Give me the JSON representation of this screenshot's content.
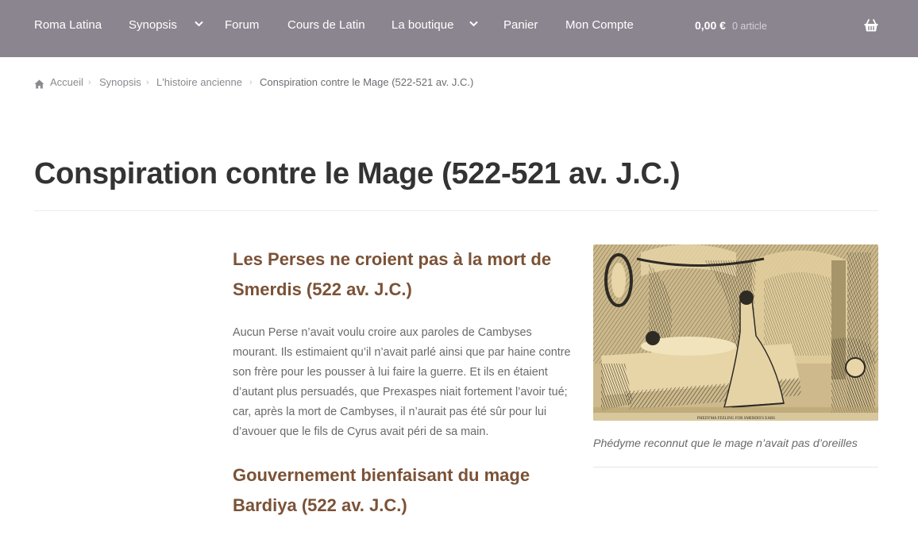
{
  "header": {
    "nav": [
      {
        "label": "Roma Latina"
      },
      {
        "label": "Synopsis",
        "has_dropdown": true
      },
      {
        "label": "Forum"
      },
      {
        "label": "Cours de Latin"
      },
      {
        "label": "La boutique",
        "has_dropdown": true
      },
      {
        "label": "Panier"
      },
      {
        "label": "Mon Compte"
      }
    ],
    "cart": {
      "total": "0,00 €",
      "count": "0 article",
      "icon": "basket-icon"
    },
    "background": "#8a858f"
  },
  "breadcrumb": {
    "items": [
      "Accueil",
      "Synopsis",
      "L'histoire ancienne"
    ],
    "current": "Conspiration contre le Mage (522-521 av. J.C.)",
    "home_icon": "home-icon"
  },
  "page": {
    "title": "Conspiration contre le Mage (522-521 av. J.C.)"
  },
  "article": {
    "heading1": "Les Perses ne croient pas à la mort de Smerdis (522 av. J.C.)",
    "paragraph1": "Aucun Perse n’avait voulu croire aux paroles de Cambyses mourant. Ils estimaient qu’il n’avait parlé ainsi que par haine contre son frère pour les pousser à lui faire la guerre. Et ils en étaient d’autant plus persuadés, que Prexaspes niait fortement l’avoir tué; car, après la mort de Cambyses, il n’aurait pas été sûr pour lui d’avouer que le fils de Cyrus avait péri de sa main.",
    "heading2": "Gouvernement bienfaisant du mage Bardiya (522 av. J.C.)",
    "heading_color": "#7b5236"
  },
  "figure": {
    "caption": "Phédyme reconnut que le mage n’avait pas d’oreilles",
    "engraving_caption": "PHEDYMA FEELING FOR SMERDIS'S EARS"
  }
}
